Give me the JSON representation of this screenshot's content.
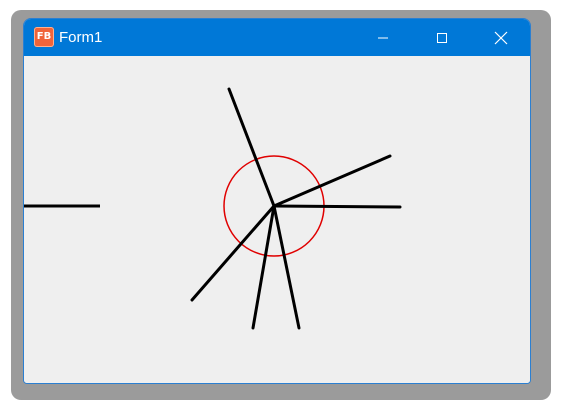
{
  "window": {
    "title": "Form1",
    "icon": "freebasic-app-icon",
    "icon_text": "FB",
    "title_bar_color": "#0078d7",
    "client_color": "#efefef"
  },
  "controls": {
    "minimize": "minimize-icon",
    "maximize": "maximize-icon",
    "close": "close-icon"
  },
  "canvas": {
    "line_color": "#000000",
    "circle_color": "#e00000"
  }
}
